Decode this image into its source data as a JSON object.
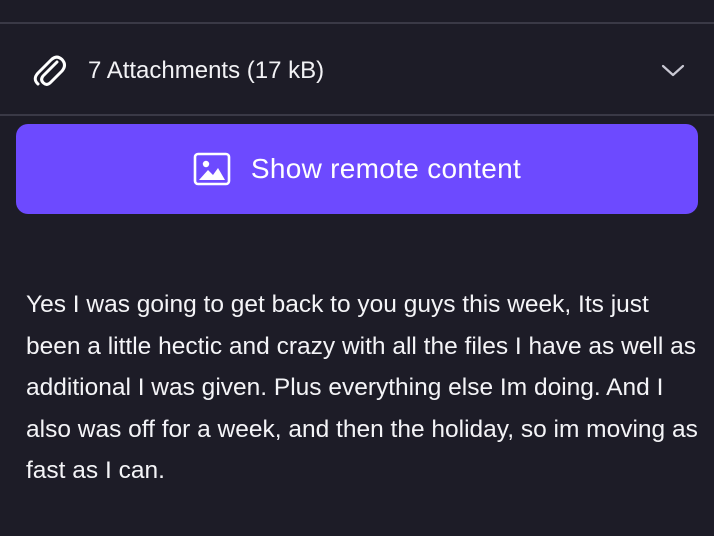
{
  "attachments": {
    "label": "7 Attachments (17 kB)",
    "icon": "paperclip-icon",
    "toggle_icon": "chevron-down-icon"
  },
  "remote_content": {
    "label": "Show remote content",
    "icon": "image-icon",
    "color": "#6d4aff"
  },
  "message": {
    "body": "Yes I was going to get back to you guys this week, Its just been a little hectic and crazy with all the files I have as well as additional I was given. Plus everything else Im doing. And I also was off for a week, and then the holiday, so im moving as fast as I can."
  },
  "theme": {
    "background": "#1d1c27",
    "divider": "#3a3946",
    "text": "#ffffff"
  }
}
